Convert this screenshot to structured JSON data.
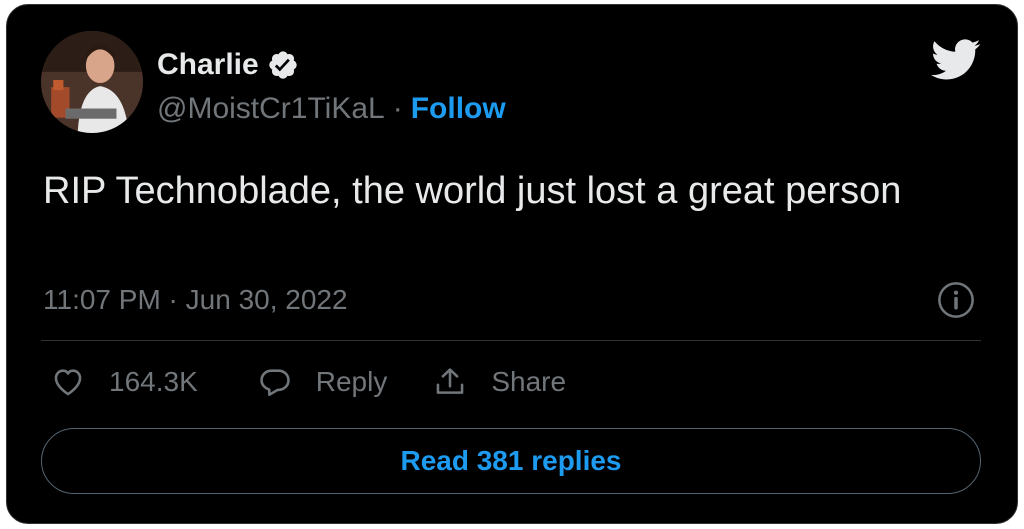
{
  "tweet": {
    "author": {
      "display_name": "Charlie",
      "handle": "@MoistCr1TiKaL",
      "verified": true
    },
    "follow_label": "Follow",
    "separator": "·",
    "text": "RIP Technoblade, the world just lost a great person",
    "timestamp": "11:07 PM · Jun 30, 2022",
    "actions": {
      "like_count": "164.3K",
      "reply_label": "Reply",
      "share_label": "Share"
    },
    "read_replies_label": "Read 381 replies"
  },
  "colors": {
    "background": "#000000",
    "text": "#e7e9ea",
    "muted": "#71767b",
    "accent": "#1d9bf0",
    "border": "#2f3336"
  },
  "icons": {
    "brand": "twitter-bird-icon",
    "verified": "verified-badge-icon",
    "info": "info-icon",
    "like": "heart-icon",
    "reply": "speech-bubble-icon",
    "share": "share-upload-icon"
  }
}
